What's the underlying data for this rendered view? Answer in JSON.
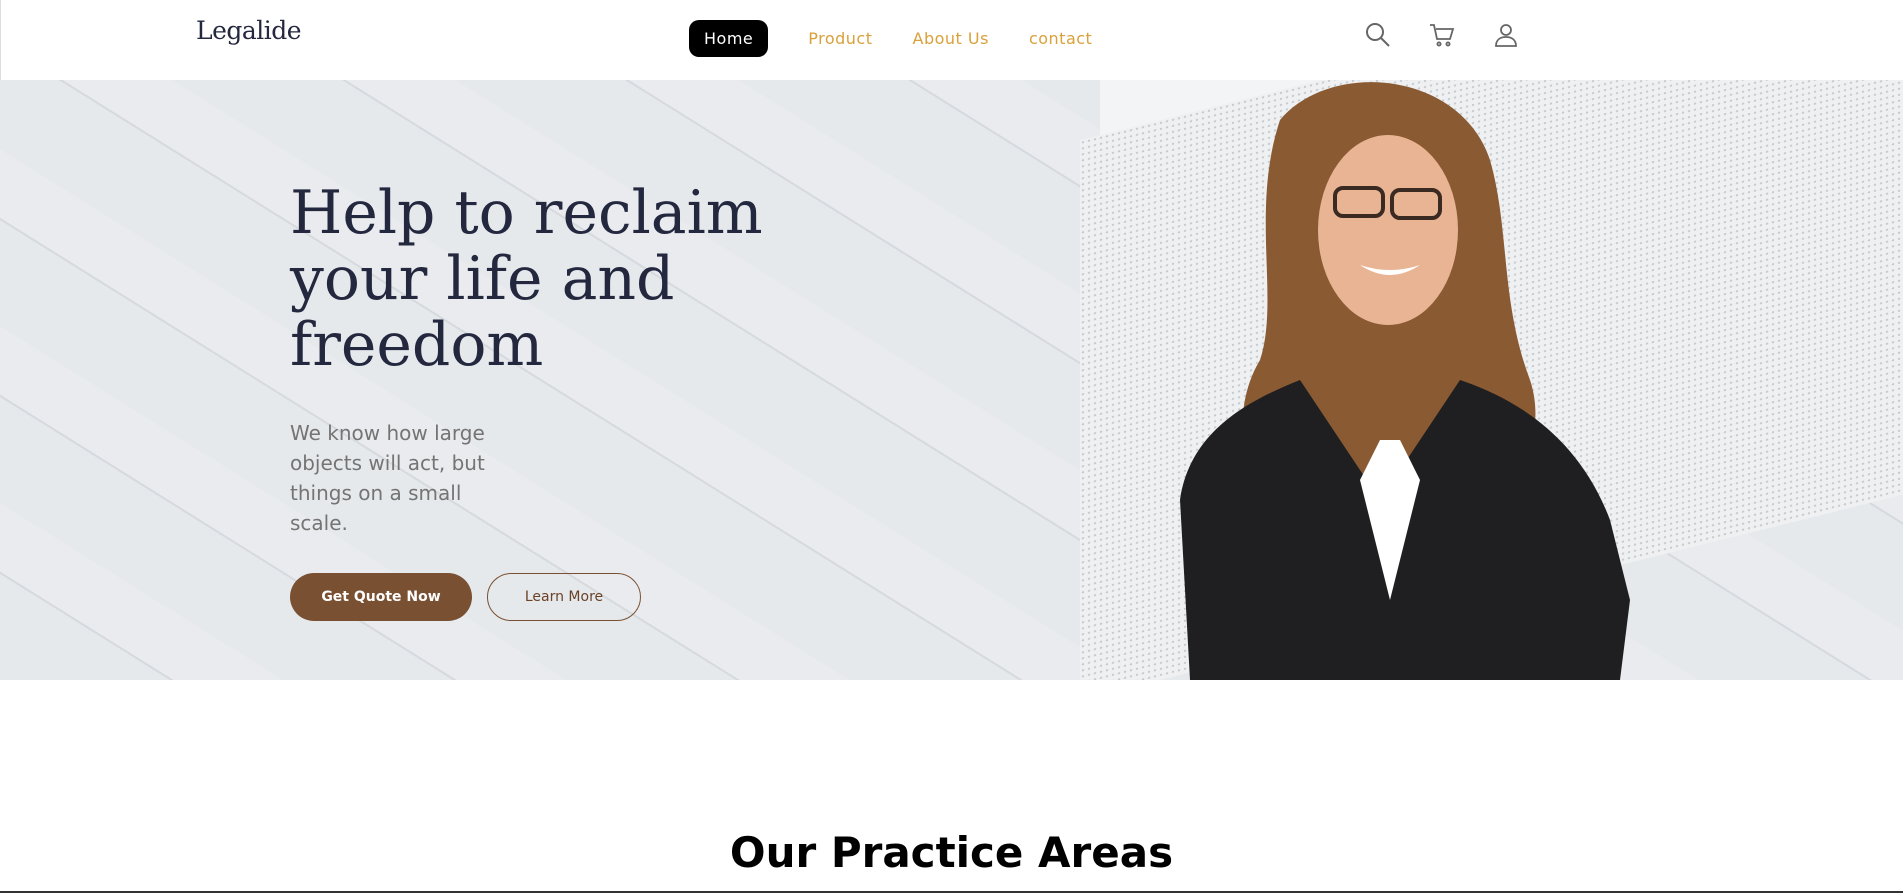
{
  "header": {
    "logo": "Legalide",
    "nav": [
      {
        "label": "Home",
        "active": true
      },
      {
        "label": "Product"
      },
      {
        "label": "About Us"
      },
      {
        "label": "contact"
      }
    ],
    "icons": [
      "search-icon",
      "cart-icon",
      "user-icon"
    ]
  },
  "hero": {
    "title": "Help to reclaim your life and freedom",
    "description": "We know how large objects will act, but things on a small scale.",
    "primary_button": "Get Quote Now",
    "secondary_button": "Learn More"
  },
  "section": {
    "title": "Our Practice Areas"
  },
  "colors": {
    "brand_brown": "#7a5032",
    "nav_gold": "#d9a13a",
    "heading": "#23283f"
  }
}
